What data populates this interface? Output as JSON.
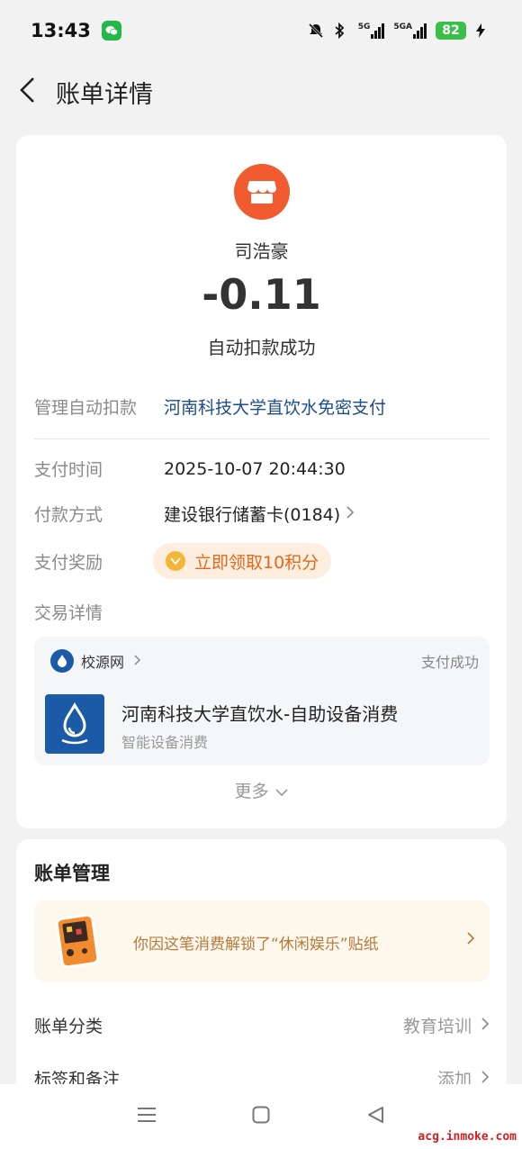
{
  "status_bar": {
    "time": "13:43",
    "network1": "5G",
    "network2": "5GA",
    "battery": "82"
  },
  "header": {
    "title": "账单详情"
  },
  "summary": {
    "merchant_name": "司浩豪",
    "amount": "-0.11",
    "status": "自动扣款成功"
  },
  "details": {
    "auto_debit_label": "管理自动扣款",
    "auto_debit_value": "河南科技大学直饮水免密支付",
    "pay_time_label": "支付时间",
    "pay_time_value": "2025-10-07 20:44:30",
    "pay_method_label": "付款方式",
    "pay_method_value": "建设银行储蓄卡(0184)",
    "reward_label": "支付奖励",
    "reward_value": "立即领取10积分",
    "txn_detail_label": "交易详情"
  },
  "transaction": {
    "source_name": "校源网",
    "status": "支付成功",
    "item_title": "河南科技大学直饮水-自助设备消费",
    "item_subtitle": "智能设备消费"
  },
  "more_label": "更多",
  "management": {
    "title": "账单管理",
    "sticker_text": "你因这笔消费解锁了“休闲娱乐”贴纸",
    "category_label": "账单分类",
    "category_value": "教育培训",
    "tags_label": "标签和备注",
    "tags_value": "添加"
  },
  "watermark": "acg.inmoke.com",
  "colors": {
    "brand_orange": "#f05b2f",
    "link_blue": "#1d4d8a",
    "reward_orange": "#e06a1b",
    "source_blue": "#1b5aa8"
  }
}
